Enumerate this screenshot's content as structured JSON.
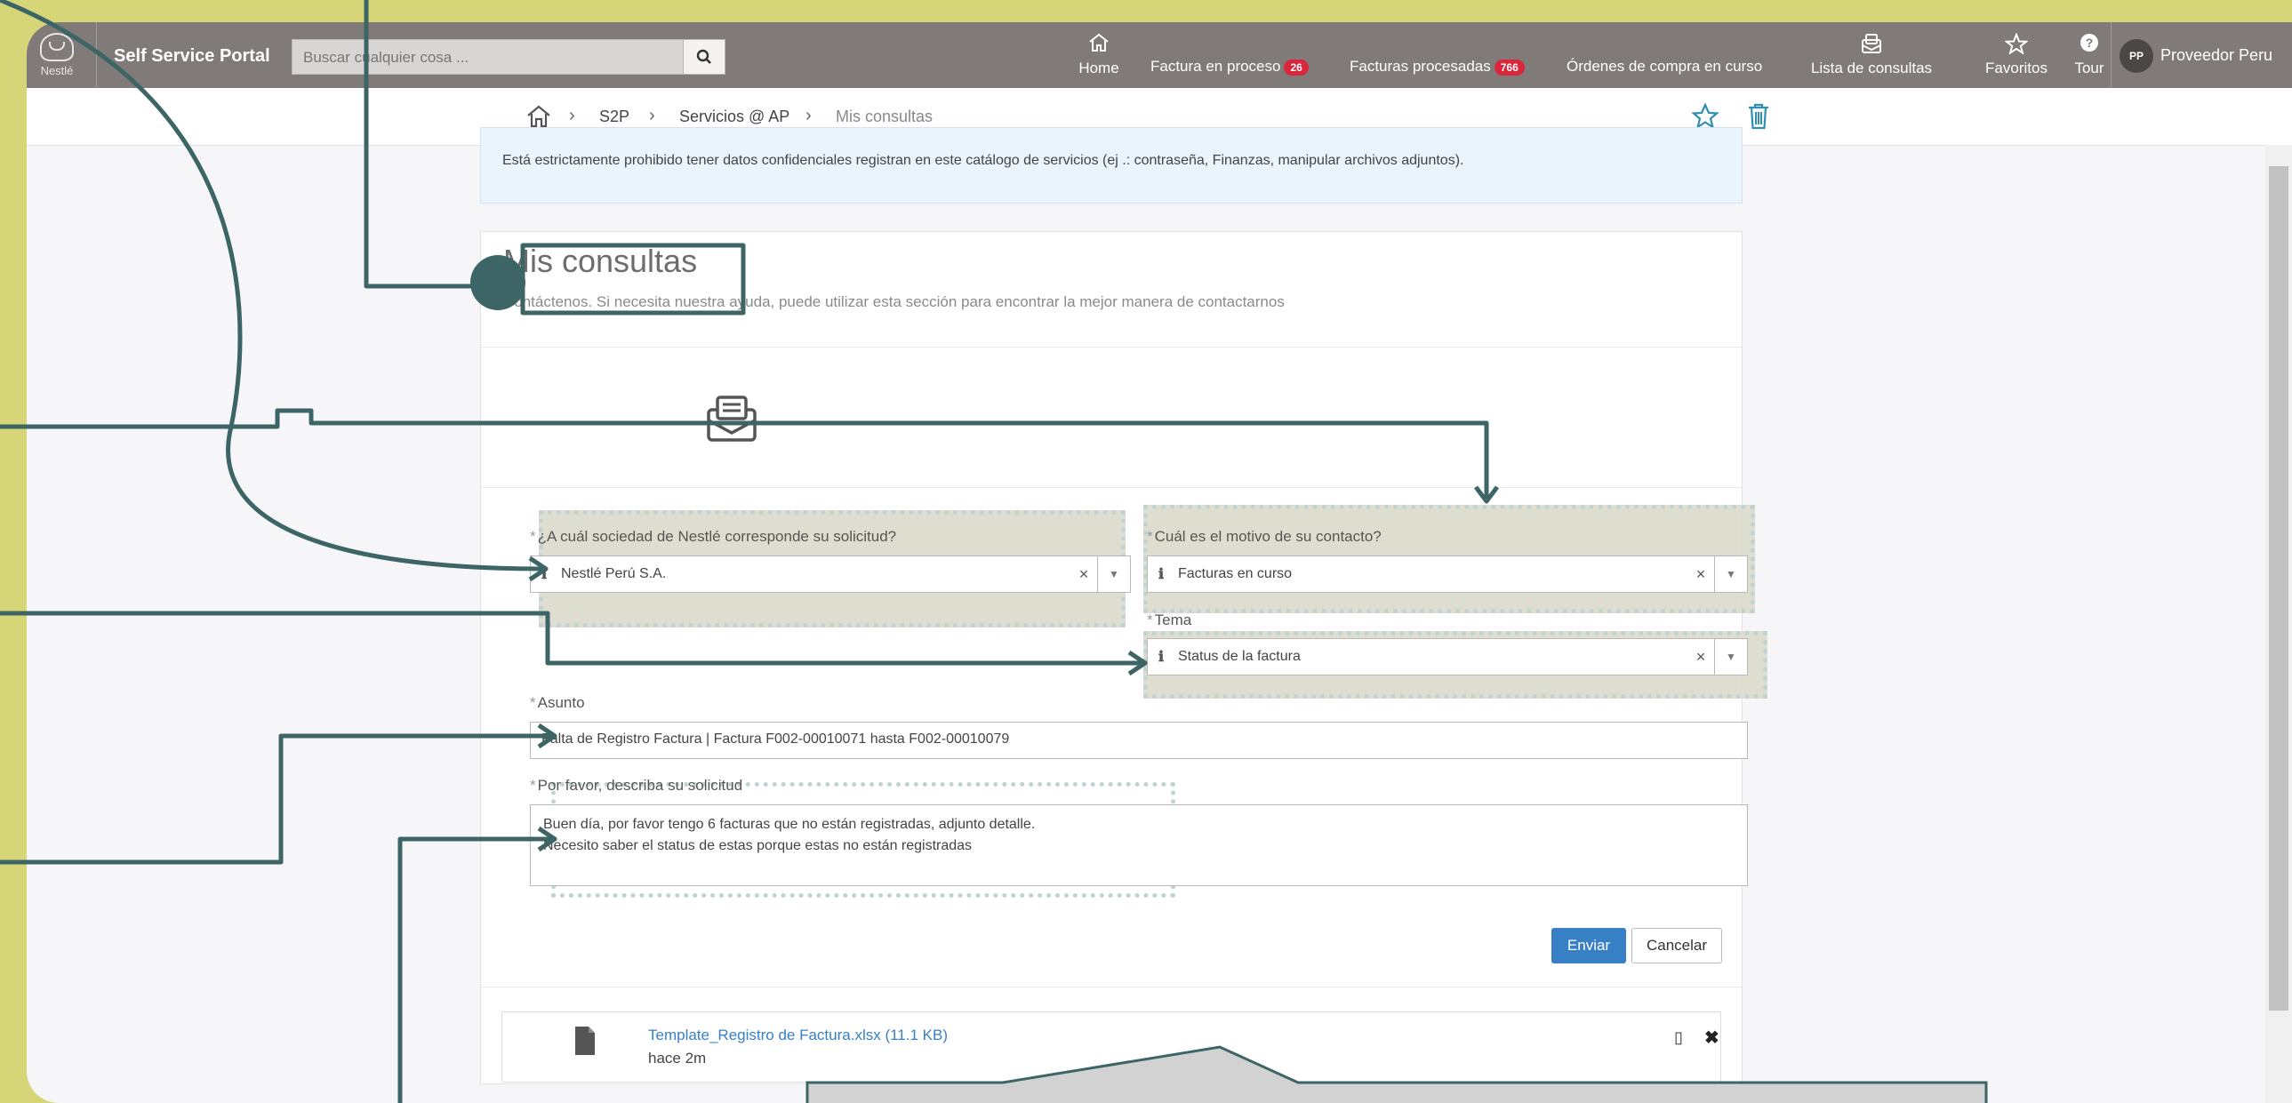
{
  "header": {
    "logo_text": "Nestlé",
    "portal_title": "Self Service Portal",
    "search_placeholder": "Buscar cualquier cosa ...",
    "nav": [
      {
        "label": "Home",
        "icon": "home-icon"
      },
      {
        "label": "Factura en proceso",
        "badge": "26"
      },
      {
        "label": "Facturas procesadas",
        "badge": "766"
      },
      {
        "label": "Órdenes de compra en curso"
      },
      {
        "label": "Lista de consultas",
        "icon": "inbox-icon"
      },
      {
        "label": "Favoritos",
        "icon": "star-icon"
      },
      {
        "label": "Tour",
        "icon": "help-icon"
      }
    ],
    "user_initials": "PP",
    "user_name": "Proveedor Peru"
  },
  "breadcrumb": {
    "items": [
      "S2P",
      "Servicios @ AP",
      "Mis consultas"
    ]
  },
  "notice": "Está estrictamente prohibido tener datos confidenciales registran en este catálogo de servicios (ej .: contraseña, Finanzas, manipular archivos adjuntos).",
  "page": {
    "title": "Mis consultas",
    "subtitle": "Contáctenos. Si necesita nuestra ayuda, puede utilizar esta sección para encontrar la mejor manera de contactarnos"
  },
  "form": {
    "sociedad": {
      "label": "¿A cuál sociedad de Nestlé corresponde su solicitud?",
      "value": "Nestlé Perú S.A."
    },
    "motivo": {
      "label": "Cuál es el motivo de su contacto?",
      "value": "Facturas en curso"
    },
    "tema": {
      "label": "Tema",
      "value": "Status de la factura"
    },
    "asunto": {
      "label": "Asunto",
      "value": "Falta de Registro Factura | Factura F002-00010071  hasta F002-00010079"
    },
    "descripcion": {
      "label": "Por favor, describa su solicitud",
      "line1": "Buen día, por favor tengo 6 facturas que no están registradas, adjunto detalle.",
      "line2": "Necesito saber el status de estas porque estas no están registradas"
    },
    "submit_label": "Enviar",
    "cancel_label": "Cancelar"
  },
  "attachment": {
    "file": "Template_Registro de Factura.xlsx (11.1 KB)",
    "time": "hace 2m"
  },
  "colors": {
    "accent": "#3780c6",
    "badge": "#d9263b",
    "annotation": "#3d6565",
    "highlight_fill": "#dcdbcc"
  }
}
